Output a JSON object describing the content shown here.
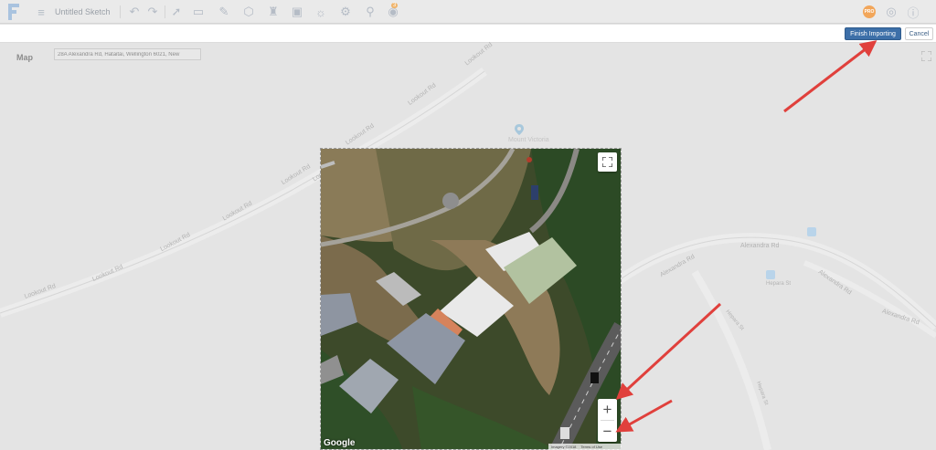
{
  "toolbar": {
    "sketch_title": "Untitled Sketch",
    "badge_count": "3",
    "avatar_initials": "PRO",
    "icons": [
      "menu-icon",
      "undo-icon",
      "redo-icon",
      "select-icon",
      "measure-icon",
      "draw-icon",
      "shape-icon",
      "walk-icon",
      "image-icon",
      "sun-icon",
      "settings-icon",
      "location-icon",
      "import-icon",
      "help-icon",
      "info-icon"
    ]
  },
  "actions": {
    "finish_label": "Finish Importing",
    "cancel_label": "Cancel"
  },
  "map": {
    "label": "Map",
    "address_value": "28A Alexandra Rd, Hataitai, Wellington 6021, New",
    "road_labels": {
      "lookout_1": "Lookout Rd",
      "lookout_2": "Lookout Rd",
      "lookout_3": "Lookout Rd",
      "lookout_4": "Lookout Rd",
      "lookout_5": "Lookout Rd",
      "lookout_6": "Lookout Rd",
      "lookout_7": "Lookout Rd",
      "lookout_8": "Lookout Rd",
      "lookout_9": "Lookout Rd",
      "alexandra_1": "Alexandra Rd",
      "alexandra_2": "Alexandra Rd",
      "alexandra_3": "Alexandra Rd",
      "alexandra_4": "Alexandra Rd",
      "hepara_1": "Hepara St",
      "hepara_2": "Hepara St",
      "hepara_3": "Hepara St"
    },
    "place_label": "Mount Victoria",
    "google_logo": "Google",
    "imagery_credit": "Imagery ©2018",
    "terms_label": "Terms of Use"
  },
  "colors": {
    "accent": "#3d6fa8",
    "arrow": "#e0403c",
    "background": "#e4e4e4"
  }
}
